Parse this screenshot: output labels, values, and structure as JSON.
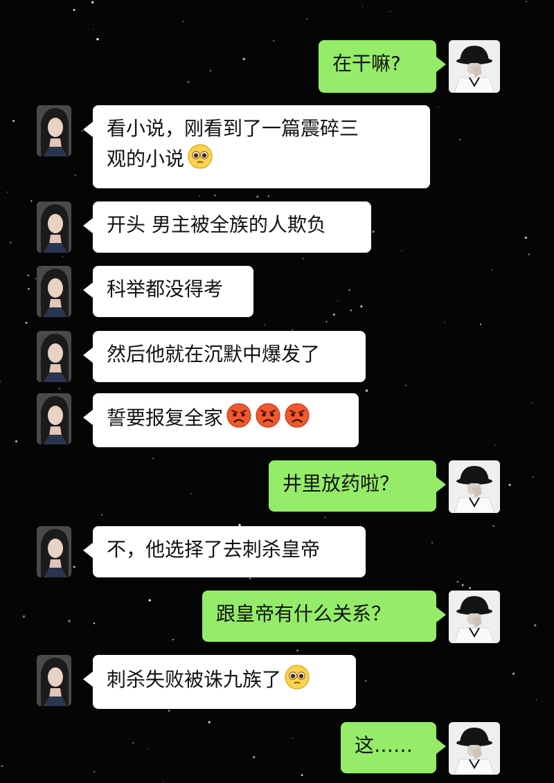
{
  "background": {
    "color": "#050505",
    "accent_sent": "#95ec69",
    "accent_received": "#ffffff"
  },
  "messages": [
    {
      "side": "right",
      "text": "在干嘛?",
      "emojis": []
    },
    {
      "side": "left",
      "text": "看小说，刚看到了一篇震碎三\n观的小说",
      "emojis": [
        "pleading-face-icon"
      ]
    },
    {
      "side": "left",
      "text": "开头 男主被全族的人欺负",
      "emojis": []
    },
    {
      "side": "left",
      "text": "科举都没得考",
      "emojis": []
    },
    {
      "side": "left",
      "text": "然后他就在沉默中爆发了",
      "emojis": []
    },
    {
      "side": "left",
      "text": "誓要报复全家",
      "emojis": [
        "angry-face-icon",
        "angry-face-icon",
        "angry-face-icon"
      ]
    },
    {
      "side": "right",
      "text": "井里放药啦？",
      "emojis": []
    },
    {
      "side": "left",
      "text": "不，他选择了去刺杀皇帝",
      "emojis": []
    },
    {
      "side": "right",
      "text": "跟皇帝有什么关系？",
      "emojis": []
    },
    {
      "side": "left",
      "text": "刺杀失败被诛九族了",
      "emojis": [
        "pleading-face-icon"
      ]
    },
    {
      "side": "right",
      "text": "这……",
      "emojis": []
    }
  ]
}
